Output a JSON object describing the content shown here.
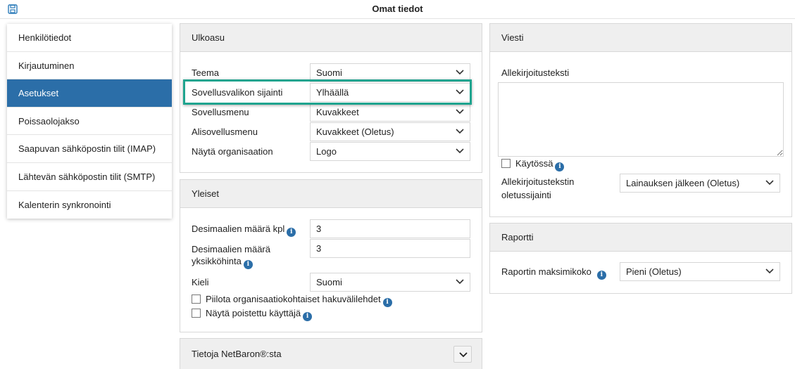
{
  "header": {
    "title": "Omat tiedot",
    "save_icon": "save-icon"
  },
  "sidebar": {
    "items": [
      {
        "label": "Henkilötiedot",
        "active": false
      },
      {
        "label": "Kirjautuminen",
        "active": false
      },
      {
        "label": "Asetukset",
        "active": true
      },
      {
        "label": "Poissaolojakso",
        "active": false
      },
      {
        "label": "Saapuvan sähköpostin tilit (IMAP)",
        "active": false
      },
      {
        "label": "Lähtevän sähköpostin tilit (SMTP)",
        "active": false
      },
      {
        "label": "Kalenterin synkronointi",
        "active": false
      }
    ]
  },
  "ulkoasu": {
    "title": "Ulkoasu",
    "rows": [
      {
        "label": "Teema",
        "value": "Suomi"
      },
      {
        "label": "Sovellusvalikon sijainti",
        "value": "Ylhäällä"
      },
      {
        "label": "Sovellusmenu",
        "value": "Kuvakkeet"
      },
      {
        "label": "Alisovellusmenu",
        "value": "Kuvakkeet (Oletus)"
      },
      {
        "label": "Näytä organisaation",
        "value": "Logo"
      }
    ]
  },
  "yleiset": {
    "title": "Yleiset",
    "decimals_label": "Desimaalien määrä kpl",
    "decimals_value": "3",
    "unit_decimals_label_1": "Desimaalien määrä",
    "unit_decimals_label_2": "yksikköhinta",
    "unit_decimals_value": "3",
    "language_label": "Kieli",
    "language_value": "Suomi",
    "hide_tabs_label": "Piilota organisaatiokohtaiset hakuvälilehdet",
    "show_deleted_label": "Näytä poistettu käyttäjä"
  },
  "about": {
    "title": "Tietoja NetBaron®:sta"
  },
  "viesti": {
    "title": "Viesti",
    "signature_label": "Allekirjoitusteksti",
    "signature_value": "",
    "in_use_label": "Käytössä",
    "default_position_label_1": "Allekirjoitustekstin",
    "default_position_label_2": "oletussijainti",
    "default_position_value": "Lainauksen jälkeen (Oletus)"
  },
  "raportti": {
    "title": "Raportti",
    "max_size_label": "Raportin maksimikoko",
    "max_size_value": "Pieni (Oletus)"
  },
  "colors": {
    "accent": "#2b6ea8",
    "highlight": "#1fa48f",
    "panel_header": "#efefef"
  }
}
